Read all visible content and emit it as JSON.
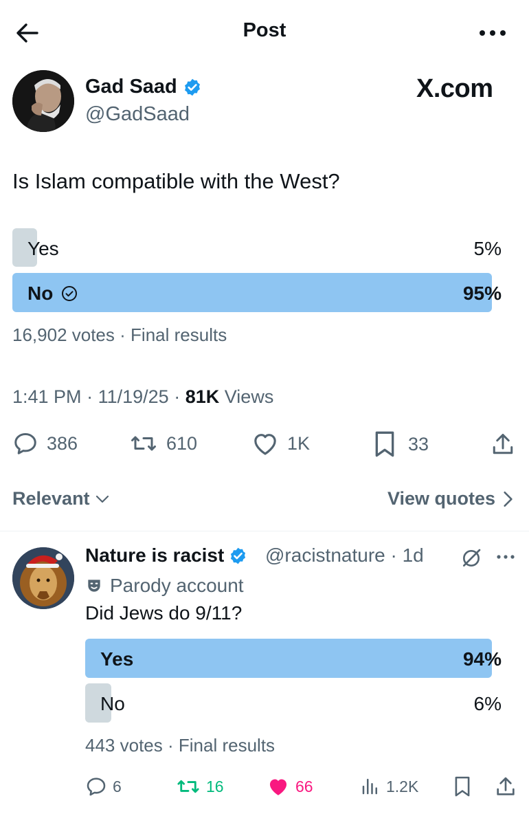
{
  "header": {
    "title": "Post",
    "back_icon": "arrow-left-icon",
    "more_icon": "more-horizontal-icon"
  },
  "post": {
    "author_name": "Gad Saad",
    "author_handle": "@GadSaad",
    "verified": true,
    "watermark": "X.com",
    "text": "Is Islam compatible with the West?",
    "poll": {
      "options": [
        {
          "label": "Yes",
          "percent": "5%",
          "value": 5,
          "winner": false
        },
        {
          "label": "No",
          "percent": "95%",
          "value": 95,
          "winner": true
        }
      ],
      "votes": "16,902 votes",
      "separator": "·",
      "status": "Final results"
    },
    "time": "1:41 PM",
    "date": "11/19/25",
    "views_count": "81K",
    "views_label": "Views",
    "actions": {
      "replies": "386",
      "reposts": "610",
      "likes": "1K",
      "bookmarks": "33"
    }
  },
  "sort": {
    "label": "Relevant",
    "quotes_label": "View quotes"
  },
  "reply": {
    "author_name": "Nature is racist",
    "author_handle": "@racistnature",
    "time_ago": "1d",
    "verified": true,
    "parody_label": "Parody account",
    "text": "Did Jews do 9/11?",
    "poll": {
      "options": [
        {
          "label": "Yes",
          "percent": "94%",
          "value": 94,
          "winner": true
        },
        {
          "label": "No",
          "percent": "6%",
          "value": 6,
          "winner": false
        }
      ],
      "votes": "443 votes",
      "status": "Final results"
    },
    "actions": {
      "replies": "6",
      "reposts": "16",
      "likes": "66",
      "views": "1.2K"
    }
  },
  "colors": {
    "poll_winner": "#8ec5f2",
    "poll_loser": "#cfd9de",
    "verified": "#1d9bf0",
    "repost_active": "#00ba7c",
    "like_active": "#f91880",
    "muted_text": "#536471"
  }
}
